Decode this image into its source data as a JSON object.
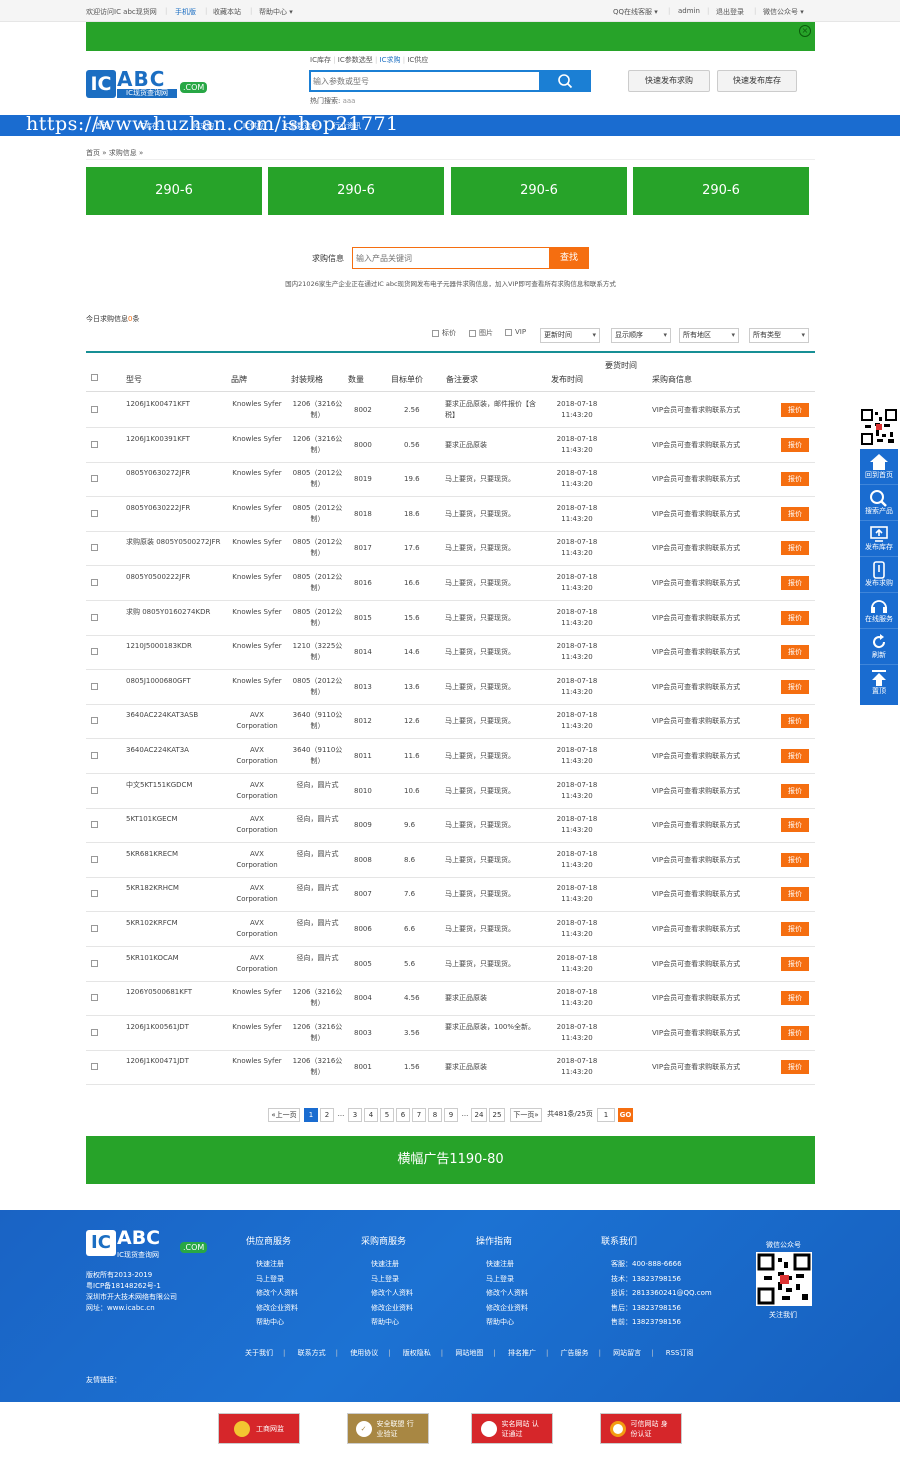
{
  "topbar": {
    "welcome": "欢迎访问IC abc现货网",
    "mobile": "手机版",
    "favorite": "收藏本站",
    "help": "帮助中心",
    "qq": "QQ在线客服",
    "user": "admin",
    "logout": "退出登录",
    "wechat": "微信公众号"
  },
  "logo": {
    "ic": "IC",
    "abc": "ABC",
    "com": ".COM",
    "sub": "IC现货查询网"
  },
  "search": {
    "tabs": [
      "IC库存",
      "IC参数选型",
      "IC求购",
      "IC供应"
    ],
    "placeholder": "输入参数或型号",
    "hot_label": "热门搜索:",
    "hot_value": "aaa"
  },
  "header_buttons": {
    "buy": "快速发布求购",
    "stock": "快速发布库存"
  },
  "nav": {
    "items": [
      "首页",
      "IC库存",
      "IC求购",
      "IC供应",
      "IC参数选型",
      "行业资讯"
    ]
  },
  "watermark": "https://www.huzhan.com/ishop21771",
  "breadcrumb": "首页 » 求购信息 »",
  "green_ads": [
    "290-6",
    "290-6",
    "290-6",
    "290-6"
  ],
  "search2": {
    "label": "求购信息",
    "placeholder": "输入产品关键词",
    "button": "查找"
  },
  "notice": "国内21026家生产企业正在通过IC abc现货网发布电子元器件求购信息，加入VIP即可查看所有求购信息和联系方式",
  "today": {
    "text": "今日求购信息",
    "count": "0",
    "unit": "条"
  },
  "filters": {
    "checks": [
      "标价",
      "图片",
      "VIP"
    ],
    "selects": [
      "更新时间",
      "显示顺序",
      "所有地区",
      "所有类型"
    ]
  },
  "table": {
    "headers": [
      "型号",
      "品牌",
      "封装规格",
      "数量",
      "目标单价",
      "备注要求",
      "发布时间",
      "要货时间",
      "采购商信息"
    ],
    "rows": [
      {
        "model": "1206J1K00471KFT",
        "brand": "Knowles Syfer",
        "pkg": "1206（3216公制）",
        "qty": "8002",
        "price": "2.56",
        "note": "要求正品原装，邮件报价【含税】",
        "time": "2018-07-18 11:43:20",
        "buyer": "VIP会员可查看求购联系方式",
        "action": "报价"
      },
      {
        "model": "1206J1K00391KFT",
        "brand": "Knowles Syfer",
        "pkg": "1206（3216公制）",
        "qty": "8000",
        "price": "0.56",
        "note": "要求正品原装",
        "time": "2018-07-18 11:43:20",
        "buyer": "VIP会员可查看求购联系方式",
        "action": "报价"
      },
      {
        "model": "0805Y0630272JFR",
        "brand": "Knowles Syfer",
        "pkg": "0805（2012公制）",
        "qty": "8019",
        "price": "19.6",
        "note": "马上要货，只要现货。",
        "time": "2018-07-18 11:43:20",
        "buyer": "VIP会员可查看求购联系方式",
        "action": "报价"
      },
      {
        "model": "0805Y0630222JFR",
        "brand": "Knowles Syfer",
        "pkg": "0805（2012公制）",
        "qty": "8018",
        "price": "18.6",
        "note": "马上要货，只要现货。",
        "time": "2018-07-18 11:43:20",
        "buyer": "VIP会员可查看求购联系方式",
        "action": "报价"
      },
      {
        "model": "求购原装 0805Y0500272JFR",
        "brand": "Knowles Syfer",
        "pkg": "0805（2012公制）",
        "qty": "8017",
        "price": "17.6",
        "note": "马上要货，只要现货。",
        "time": "2018-07-18 11:43:20",
        "buyer": "VIP会员可查看求购联系方式",
        "action": "报价"
      },
      {
        "model": "0805Y0500222JFR",
        "brand": "Knowles Syfer",
        "pkg": "0805（2012公制）",
        "qty": "8016",
        "price": "16.6",
        "note": "马上要货，只要现货。",
        "time": "2018-07-18 11:43:20",
        "buyer": "VIP会员可查看求购联系方式",
        "action": "报价"
      },
      {
        "model": "求购 0805Y0160274KDR",
        "brand": "Knowles Syfer",
        "pkg": "0805（2012公制）",
        "qty": "8015",
        "price": "15.6",
        "note": "马上要货，只要现货。",
        "time": "2018-07-18 11:43:20",
        "buyer": "VIP会员可查看求购联系方式",
        "action": "报价"
      },
      {
        "model": "1210J5000183KDR",
        "brand": "Knowles Syfer",
        "pkg": "1210（3225公制）",
        "qty": "8014",
        "price": "14.6",
        "note": "马上要货，只要现货。",
        "time": "2018-07-18 11:43:20",
        "buyer": "VIP会员可查看求购联系方式",
        "action": "报价"
      },
      {
        "model": "0805J1000680GFT",
        "brand": "Knowles Syfer",
        "pkg": "0805（2012公制）",
        "qty": "8013",
        "price": "13.6",
        "note": "马上要货，只要现货。",
        "time": "2018-07-18 11:43:20",
        "buyer": "VIP会员可查看求购联系方式",
        "action": "报价"
      },
      {
        "model": "3640AC224KAT3ASB",
        "brand": "AVX Corporation",
        "pkg": "3640（9110公制）",
        "qty": "8012",
        "price": "12.6",
        "note": "马上要货，只要现货。",
        "time": "2018-07-18 11:43:20",
        "buyer": "VIP会员可查看求购联系方式",
        "action": "报价"
      },
      {
        "model": "3640AC224KAT3A",
        "brand": "AVX Corporation",
        "pkg": "3640（9110公制）",
        "qty": "8011",
        "price": "11.6",
        "note": "马上要货，只要现货。",
        "time": "2018-07-18 11:43:20",
        "buyer": "VIP会员可查看求购联系方式",
        "action": "报价"
      },
      {
        "model": "中文5KT151KGDCM",
        "brand": "AVX Corporation",
        "pkg": "径向，圆片式",
        "qty": "8010",
        "price": "10.6",
        "note": "马上要货，只要现货。",
        "time": "2018-07-18 11:43:20",
        "buyer": "VIP会员可查看求购联系方式",
        "action": "报价"
      },
      {
        "model": "5KT101KGECM",
        "brand": "AVX Corporation",
        "pkg": "径向，圆片式",
        "qty": "8009",
        "price": "9.6",
        "note": "马上要货，只要现货。",
        "time": "2018-07-18 11:43:20",
        "buyer": "VIP会员可查看求购联系方式",
        "action": "报价"
      },
      {
        "model": "5KR681KRECM",
        "brand": "AVX Corporation",
        "pkg": "径向，圆片式",
        "qty": "8008",
        "price": "8.6",
        "note": "马上要货，只要现货。",
        "time": "2018-07-18 11:43:20",
        "buyer": "VIP会员可查看求购联系方式",
        "action": "报价"
      },
      {
        "model": "5KR182KRHCM",
        "brand": "AVX Corporation",
        "pkg": "径向，圆片式",
        "qty": "8007",
        "price": "7.6",
        "note": "马上要货，只要现货。",
        "time": "2018-07-18 11:43:20",
        "buyer": "VIP会员可查看求购联系方式",
        "action": "报价"
      },
      {
        "model": "5KR102KRFCM",
        "brand": "AVX Corporation",
        "pkg": "径向，圆片式",
        "qty": "8006",
        "price": "6.6",
        "note": "马上要货，只要现货。",
        "time": "2018-07-18 11:43:20",
        "buyer": "VIP会员可查看求购联系方式",
        "action": "报价"
      },
      {
        "model": "5KR101KOCAM",
        "brand": "AVX Corporation",
        "pkg": "径向，圆片式",
        "qty": "8005",
        "price": "5.6",
        "note": "马上要货，只要现货。",
        "time": "2018-07-18 11:43:20",
        "buyer": "VIP会员可查看求购联系方式",
        "action": "报价"
      },
      {
        "model": "1206Y0500681KFT",
        "brand": "Knowles Syfer",
        "pkg": "1206（3216公制）",
        "qty": "8004",
        "price": "4.56",
        "note": "要求正品原装",
        "time": "2018-07-18 11:43:20",
        "buyer": "VIP会员可查看求购联系方式",
        "action": "报价"
      },
      {
        "model": "1206J1K00561JDT",
        "brand": "Knowles Syfer",
        "pkg": "1206（3216公制）",
        "qty": "8003",
        "price": "3.56",
        "note": "要求正品原装，100%全新。",
        "time": "2018-07-18 11:43:20",
        "buyer": "VIP会员可查看求购联系方式",
        "action": "报价"
      },
      {
        "model": "1206J1K00471JDT",
        "brand": "Knowles Syfer",
        "pkg": "1206（3216公制）",
        "qty": "8001",
        "price": "1.56",
        "note": "要求正品原装",
        "time": "2018-07-18 11:43:20",
        "buyer": "VIP会员可查看求购联系方式",
        "action": "报价"
      }
    ]
  },
  "pagination": {
    "prev": "«上一页",
    "pages": [
      "1",
      "2",
      "...",
      "3",
      "4",
      "5",
      "6",
      "7",
      "8",
      "9",
      "...",
      "24",
      "25"
    ],
    "next": "下一页»",
    "total": "共481条/25页",
    "input": "1",
    "go": "GO"
  },
  "banner": "横幅广告1190-80",
  "footer": {
    "copyright": "版权所有2013-2019",
    "icp": "粤ICP备18148262号-1",
    "company": "深圳市开大技术网络有限公司",
    "website": "网址：www.icabc.cn",
    "cols": [
      {
        "title": "供应商服务",
        "items": [
          "快速注册",
          "马上登录",
          "修改个人资料",
          "修改企业资料",
          "帮助中心"
        ]
      },
      {
        "title": "采购商服务",
        "items": [
          "快速注册",
          "马上登录",
          "修改个人资料",
          "修改企业资料",
          "帮助中心"
        ]
      },
      {
        "title": "操作指南",
        "items": [
          "快速注册",
          "马上登录",
          "修改个人资料",
          "修改企业资料",
          "帮助中心"
        ]
      }
    ],
    "contact": {
      "title": "联系我们",
      "items": [
        "客服：400-888-6666",
        "技术：13823798156",
        "投诉：2813360241@QQ.com",
        "售后：13823798156",
        "售前：13823798156"
      ]
    },
    "wechat_title": "微信公众号",
    "follow": "关注我们",
    "links": [
      "关于我们",
      "联系方式",
      "使用协议",
      "版权隐私",
      "网站地图",
      "排名推广",
      "广告服务",
      "网站留言",
      "RSS订阅"
    ],
    "friend_label": "友情链接："
  },
  "certs": [
    "工商网监",
    "安全联盟 行业验证",
    "实名网站 认证通过",
    "可信网站 身份认证"
  ],
  "side": [
    "回到首页",
    "搜索产品",
    "发布库存",
    "发布求购",
    "在线服务",
    "刷新",
    "置顶"
  ],
  "colors": {
    "blue": "#1a6cd0",
    "green": "#27a329",
    "orange": "#f56e10",
    "teal": "#178f95"
  }
}
